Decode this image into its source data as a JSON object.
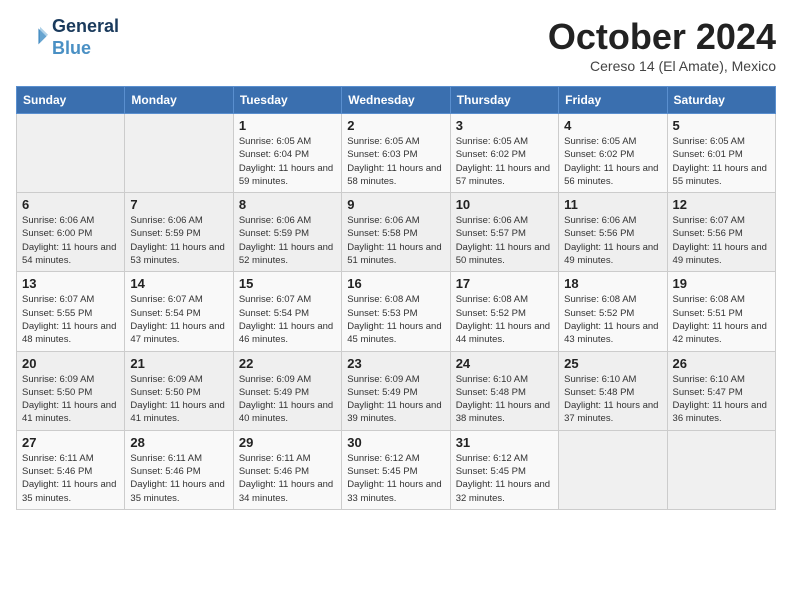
{
  "header": {
    "logo_line1": "General",
    "logo_line2": "Blue",
    "month": "October 2024",
    "location": "Cereso 14 (El Amate), Mexico"
  },
  "weekdays": [
    "Sunday",
    "Monday",
    "Tuesday",
    "Wednesday",
    "Thursday",
    "Friday",
    "Saturday"
  ],
  "weeks": [
    [
      {
        "day": "",
        "info": ""
      },
      {
        "day": "",
        "info": ""
      },
      {
        "day": "1",
        "info": "Sunrise: 6:05 AM\nSunset: 6:04 PM\nDaylight: 11 hours and 59 minutes."
      },
      {
        "day": "2",
        "info": "Sunrise: 6:05 AM\nSunset: 6:03 PM\nDaylight: 11 hours and 58 minutes."
      },
      {
        "day": "3",
        "info": "Sunrise: 6:05 AM\nSunset: 6:02 PM\nDaylight: 11 hours and 57 minutes."
      },
      {
        "day": "4",
        "info": "Sunrise: 6:05 AM\nSunset: 6:02 PM\nDaylight: 11 hours and 56 minutes."
      },
      {
        "day": "5",
        "info": "Sunrise: 6:05 AM\nSunset: 6:01 PM\nDaylight: 11 hours and 55 minutes."
      }
    ],
    [
      {
        "day": "6",
        "info": "Sunrise: 6:06 AM\nSunset: 6:00 PM\nDaylight: 11 hours and 54 minutes."
      },
      {
        "day": "7",
        "info": "Sunrise: 6:06 AM\nSunset: 5:59 PM\nDaylight: 11 hours and 53 minutes."
      },
      {
        "day": "8",
        "info": "Sunrise: 6:06 AM\nSunset: 5:59 PM\nDaylight: 11 hours and 52 minutes."
      },
      {
        "day": "9",
        "info": "Sunrise: 6:06 AM\nSunset: 5:58 PM\nDaylight: 11 hours and 51 minutes."
      },
      {
        "day": "10",
        "info": "Sunrise: 6:06 AM\nSunset: 5:57 PM\nDaylight: 11 hours and 50 minutes."
      },
      {
        "day": "11",
        "info": "Sunrise: 6:06 AM\nSunset: 5:56 PM\nDaylight: 11 hours and 49 minutes."
      },
      {
        "day": "12",
        "info": "Sunrise: 6:07 AM\nSunset: 5:56 PM\nDaylight: 11 hours and 49 minutes."
      }
    ],
    [
      {
        "day": "13",
        "info": "Sunrise: 6:07 AM\nSunset: 5:55 PM\nDaylight: 11 hours and 48 minutes."
      },
      {
        "day": "14",
        "info": "Sunrise: 6:07 AM\nSunset: 5:54 PM\nDaylight: 11 hours and 47 minutes."
      },
      {
        "day": "15",
        "info": "Sunrise: 6:07 AM\nSunset: 5:54 PM\nDaylight: 11 hours and 46 minutes."
      },
      {
        "day": "16",
        "info": "Sunrise: 6:08 AM\nSunset: 5:53 PM\nDaylight: 11 hours and 45 minutes."
      },
      {
        "day": "17",
        "info": "Sunrise: 6:08 AM\nSunset: 5:52 PM\nDaylight: 11 hours and 44 minutes."
      },
      {
        "day": "18",
        "info": "Sunrise: 6:08 AM\nSunset: 5:52 PM\nDaylight: 11 hours and 43 minutes."
      },
      {
        "day": "19",
        "info": "Sunrise: 6:08 AM\nSunset: 5:51 PM\nDaylight: 11 hours and 42 minutes."
      }
    ],
    [
      {
        "day": "20",
        "info": "Sunrise: 6:09 AM\nSunset: 5:50 PM\nDaylight: 11 hours and 41 minutes."
      },
      {
        "day": "21",
        "info": "Sunrise: 6:09 AM\nSunset: 5:50 PM\nDaylight: 11 hours and 41 minutes."
      },
      {
        "day": "22",
        "info": "Sunrise: 6:09 AM\nSunset: 5:49 PM\nDaylight: 11 hours and 40 minutes."
      },
      {
        "day": "23",
        "info": "Sunrise: 6:09 AM\nSunset: 5:49 PM\nDaylight: 11 hours and 39 minutes."
      },
      {
        "day": "24",
        "info": "Sunrise: 6:10 AM\nSunset: 5:48 PM\nDaylight: 11 hours and 38 minutes."
      },
      {
        "day": "25",
        "info": "Sunrise: 6:10 AM\nSunset: 5:48 PM\nDaylight: 11 hours and 37 minutes."
      },
      {
        "day": "26",
        "info": "Sunrise: 6:10 AM\nSunset: 5:47 PM\nDaylight: 11 hours and 36 minutes."
      }
    ],
    [
      {
        "day": "27",
        "info": "Sunrise: 6:11 AM\nSunset: 5:46 PM\nDaylight: 11 hours and 35 minutes."
      },
      {
        "day": "28",
        "info": "Sunrise: 6:11 AM\nSunset: 5:46 PM\nDaylight: 11 hours and 35 minutes."
      },
      {
        "day": "29",
        "info": "Sunrise: 6:11 AM\nSunset: 5:46 PM\nDaylight: 11 hours and 34 minutes."
      },
      {
        "day": "30",
        "info": "Sunrise: 6:12 AM\nSunset: 5:45 PM\nDaylight: 11 hours and 33 minutes."
      },
      {
        "day": "31",
        "info": "Sunrise: 6:12 AM\nSunset: 5:45 PM\nDaylight: 11 hours and 32 minutes."
      },
      {
        "day": "",
        "info": ""
      },
      {
        "day": "",
        "info": ""
      }
    ]
  ]
}
